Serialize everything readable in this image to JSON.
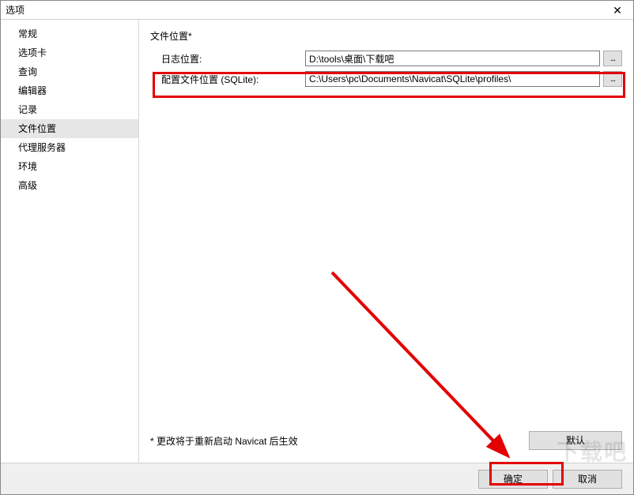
{
  "window": {
    "title": "选项"
  },
  "sidebar": {
    "items": [
      {
        "label": "常规",
        "selected": false
      },
      {
        "label": "选项卡",
        "selected": false
      },
      {
        "label": "查询",
        "selected": false
      },
      {
        "label": "编辑器",
        "selected": false
      },
      {
        "label": "记录",
        "selected": false
      },
      {
        "label": "文件位置",
        "selected": true
      },
      {
        "label": "代理服务器",
        "selected": false
      },
      {
        "label": "环境",
        "selected": false
      },
      {
        "label": "高级",
        "selected": false
      }
    ]
  },
  "main": {
    "section_title": "文件位置*",
    "rows": [
      {
        "label": "日志位置:",
        "value": "D:\\tools\\桌面\\下载吧",
        "browse": "..."
      },
      {
        "label": "配置文件位置 (SQLite):",
        "value": "C:\\Users\\pc\\Documents\\Navicat\\SQLite\\profiles\\",
        "browse": "..."
      }
    ],
    "note": "* 更改将于重新启动 Navicat 后生效",
    "default_button": "默认"
  },
  "footer": {
    "ok": "确定",
    "cancel": "取消"
  },
  "watermark": "下载吧",
  "icons": {
    "close": "✕"
  }
}
